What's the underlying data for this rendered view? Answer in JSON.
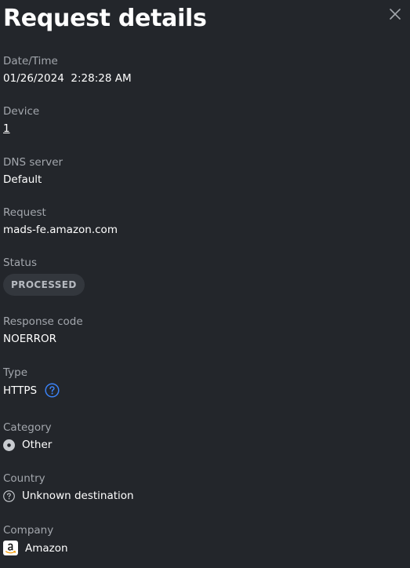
{
  "header": {
    "title": "Request details",
    "close_icon": "close-icon"
  },
  "fields": {
    "datetime": {
      "label": "Date/Time",
      "value": "01/26/2024  2:28:28 AM"
    },
    "device": {
      "label": "Device",
      "value": "1"
    },
    "dns_server": {
      "label": "DNS server",
      "value": "Default"
    },
    "request": {
      "label": "Request",
      "value": "mads-fe.amazon.com"
    },
    "status": {
      "label": "Status",
      "value": "PROCESSED"
    },
    "response_code": {
      "label": "Response code",
      "value": "NOERROR"
    },
    "type": {
      "label": "Type",
      "value": "HTTPS",
      "icon": "help-icon"
    },
    "category": {
      "label": "Category",
      "value": "Other",
      "icon": "category-dot-icon"
    },
    "country": {
      "label": "Country",
      "value": "Unknown destination",
      "icon": "unknown-destination-icon"
    },
    "company": {
      "label": "Company",
      "value": "Amazon",
      "icon": "amazon-logo-icon"
    }
  },
  "colors": {
    "background": "#23262b",
    "label": "#a3a7ad",
    "text": "#ffffff",
    "badge_bg": "#33373d",
    "badge_text": "#b6bac0",
    "accent": "#3b82f6"
  }
}
